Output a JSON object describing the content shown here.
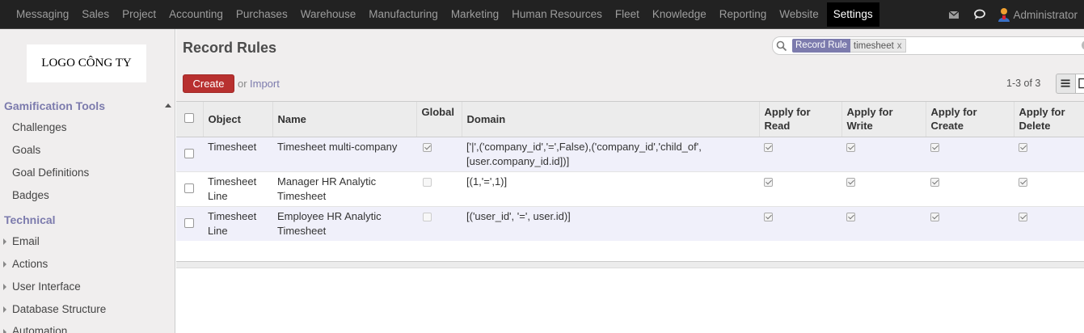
{
  "topbar": {
    "menu": [
      "Messaging",
      "Sales",
      "Project",
      "Accounting",
      "Purchases",
      "Warehouse",
      "Manufacturing",
      "Marketing",
      "Human Resources",
      "Fleet",
      "Knowledge",
      "Reporting",
      "Website",
      "Settings"
    ],
    "active": "Settings",
    "user": "Administrator",
    "icons": [
      "mail-icon",
      "chat-icon",
      "user-avatar-icon"
    ]
  },
  "sidebar": {
    "logo_text": "LOGO CÔNG TY",
    "sections": [
      {
        "title": "Gamification Tools",
        "items": [
          "Challenges",
          "Goals",
          "Goal Definitions",
          "Badges"
        ]
      },
      {
        "title": "Technical",
        "items": [
          "Email",
          "Actions",
          "User Interface",
          "Database Structure",
          "Automation"
        ]
      }
    ]
  },
  "control": {
    "title": "Record Rules",
    "search": {
      "facet_category": "Record Rule",
      "facet_value": "timesheet",
      "facet_remove": "x"
    },
    "create_label": "Create",
    "or_text": "or",
    "import_label": "Import",
    "pager": "1-3 of 3"
  },
  "table": {
    "headers": {
      "object": "Object",
      "name": "Name",
      "global": "Global",
      "domain": "Domain",
      "read": [
        "Apply for",
        "Read"
      ],
      "write": [
        "Apply for",
        "Write"
      ],
      "create": [
        "Apply for",
        "Create"
      ],
      "delete": [
        "Apply for",
        "Delete"
      ]
    },
    "rows": [
      {
        "object": [
          "Timesheet"
        ],
        "name": [
          "Timesheet multi-company"
        ],
        "global": true,
        "domain": [
          "['|',('company_id','=',False),('company_id','child_of',",
          "[user.company_id.id])]"
        ],
        "read": true,
        "write": true,
        "create": true,
        "delete": true
      },
      {
        "object": [
          "Timesheet",
          "Line"
        ],
        "name": [
          "Manager HR Analytic",
          "Timesheet"
        ],
        "global": false,
        "domain": [
          "[(1,'=',1)]"
        ],
        "read": true,
        "write": true,
        "create": true,
        "delete": true
      },
      {
        "object": [
          "Timesheet",
          "Line"
        ],
        "name": [
          "Employee HR Analytic",
          "Timesheet"
        ],
        "global": false,
        "domain": [
          "[('user_id', '=', user.id)]"
        ],
        "read": true,
        "write": true,
        "create": true,
        "delete": true
      }
    ]
  },
  "colors": {
    "topbar_bg": "#222222",
    "accent": "#7c7bad",
    "create_button": "#b8302f",
    "sidebar_bg": "#f0eeee",
    "selected_row": "#f0f0fa"
  }
}
